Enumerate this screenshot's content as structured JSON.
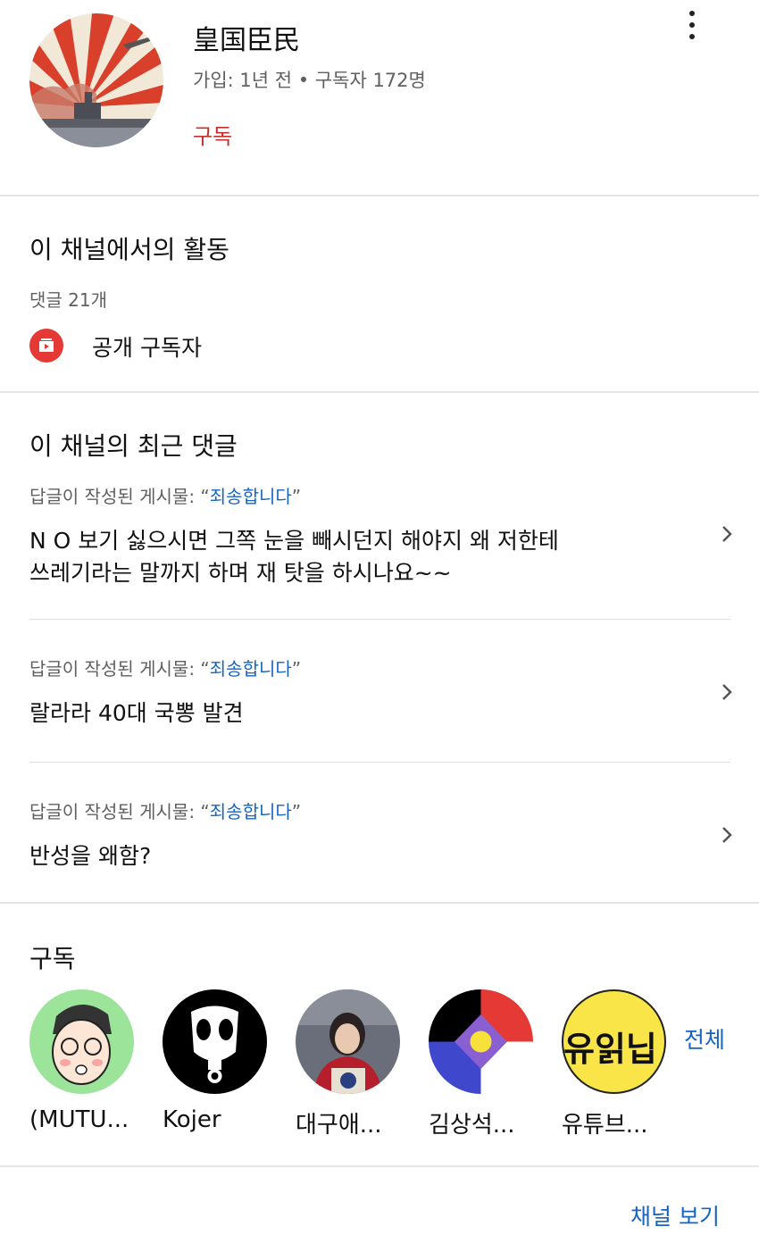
{
  "channel": {
    "name": "皇国臣民",
    "meta": "가입: 1년 전 • 구독자 172명",
    "subscribe_label": "구독",
    "avatar_icon": "rising-sun-battleship-avatar",
    "more_icon": "more-vertical-icon"
  },
  "activity": {
    "title": "이 채널에서의 활동",
    "comment_count": "댓글 21개",
    "public_subscriber_label": "공개 구독자",
    "public_subscriber_icon": "subscriptions-icon"
  },
  "recent_comments": {
    "title": "이 채널의 최근 댓글",
    "items": [
      {
        "context_prefix": "답글이 작성된 게시물: “",
        "context_link": "죄송합니다",
        "context_suffix": "”",
        "text_line1": "N O 보기 싫으시면 그쪽 눈을 빼시던지 해야지 왜 저한테",
        "text_line2": "쓰레기라는 말까지 하며 재 탓을 하시나요~~"
      },
      {
        "context_prefix": "답글이 작성된 게시물: “",
        "context_link": "죄송합니다",
        "context_suffix": "”",
        "text_line1": "랄라라 40대 국뽕 발견",
        "text_line2": ""
      },
      {
        "context_prefix": "답글이 작성된 게시물: “",
        "context_link": "죄송합니다",
        "context_suffix": "”",
        "text_line1": "반성을 왜함?",
        "text_line2": ""
      }
    ]
  },
  "subscriptions": {
    "title": "구독",
    "view_all_label": "전체",
    "items": [
      {
        "label": "(MUTU...",
        "icon": "cartoon-face-avatar"
      },
      {
        "label": "Kojer",
        "icon": "gas-mask-avatar"
      },
      {
        "label": "대구애...",
        "icon": "photo-avatar"
      },
      {
        "label": "김상석...",
        "icon": "flag-avatar"
      },
      {
        "label": "유튜브...",
        "icon": "yellow-text-avatar",
        "avatar_text": "유읽닙"
      }
    ]
  },
  "footer": {
    "view_channel_label": "채널 보기"
  },
  "colors": {
    "subscribe": "#c4302b",
    "link": "#1565c0",
    "muted": "#606060"
  }
}
